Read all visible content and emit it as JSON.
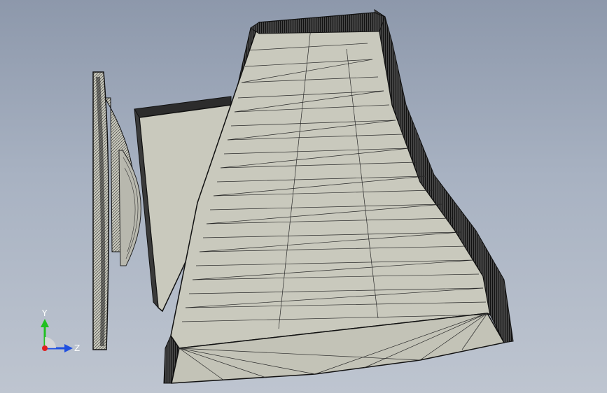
{
  "view": {
    "colors": {
      "background_top": "#8d98ab",
      "background_bottom": "#bec5d0",
      "face_fill": "#c9c9bd",
      "mesh_edge": "#1e1e1e",
      "axis_x": "#e02020",
      "axis_y": "#20c020",
      "axis_z": "#2050e0"
    }
  },
  "triad": {
    "y_label": "Y",
    "z_label": "Z"
  }
}
